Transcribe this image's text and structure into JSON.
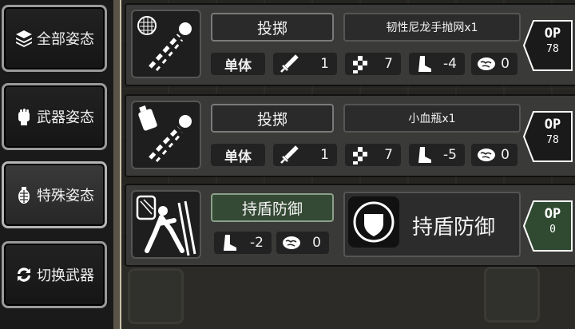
{
  "menu": [
    {
      "label": "全部姿态",
      "icon": "stack-icon"
    },
    {
      "label": "武器姿态",
      "icon": "fist-icon"
    },
    {
      "label": "特殊姿态",
      "icon": "grenade-icon"
    },
    {
      "label": "切换武器",
      "icon": "swap-icon"
    }
  ],
  "cards": [
    {
      "action": "投掷",
      "item": "韧性尼龙手抛网x1",
      "type_label": "单体",
      "attack": "1",
      "accuracy": "7",
      "move": "-4",
      "brain": "0",
      "op_label": "OP",
      "op_value": "78",
      "portrait_icon": "throw-net-icon"
    },
    {
      "action": "投掷",
      "item": "小血瓶x1",
      "type_label": "单体",
      "attack": "1",
      "accuracy": "7",
      "move": "-5",
      "brain": "0",
      "op_label": "OP",
      "op_value": "78",
      "portrait_icon": "throw-potion-icon"
    },
    {
      "action": "持盾防御",
      "move": "-2",
      "brain": "0",
      "skill_title": "持盾防御",
      "op_label": "OP",
      "op_value": "0",
      "portrait_icon": "shield-defense-icon",
      "skill_icon": "shield-icon"
    }
  ],
  "colors": {
    "panel": "#3a3a38",
    "green_button": "#354a35",
    "op_green": "#2f4a30",
    "op_dark": "#1a1a1a"
  }
}
